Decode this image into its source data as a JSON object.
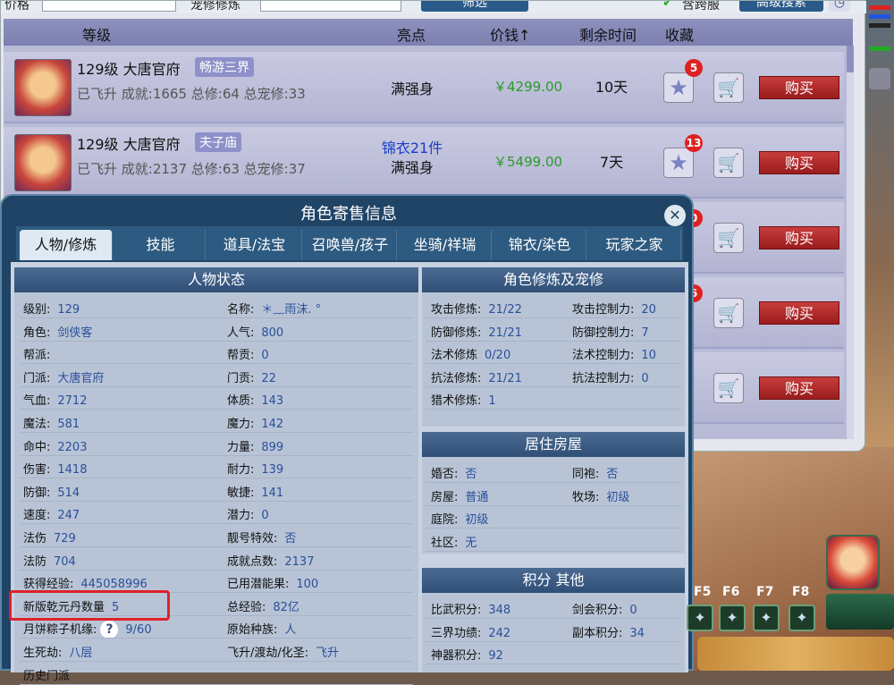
{
  "filter_bar": {
    "price_label": "价格",
    "cultivation_label": "宠修修炼",
    "filter_button": "筛选",
    "cross_server_label": "含跨服",
    "advanced_search": "高级搜索"
  },
  "list_header": {
    "grade": "等级",
    "highlight": "亮点",
    "price": "价钱",
    "remaining": "剩余时间",
    "favorite": "收藏"
  },
  "listings": [
    {
      "title": "129级 大唐官府",
      "tag": "畅游三界",
      "sub": "已飞升 成就:1665 总修:64 总宠修:33",
      "highlight": [
        "满强身"
      ],
      "price": "￥4299.00",
      "time": "10天",
      "fav_count": "5",
      "buy_label": "购买"
    },
    {
      "title": "129级 大唐官府",
      "tag": "夫子庙",
      "sub": "已飞升 成就:2137 总修:63 总宠修:37",
      "highlight": [
        "锦衣21件",
        "满强身"
      ],
      "price": "￥5499.00",
      "time": "7天",
      "fav_count": "13",
      "buy_label": "购买"
    },
    {
      "buy_label": "购买",
      "fav_count": "0"
    },
    {
      "buy_label": "购买",
      "fav_count": "6"
    },
    {
      "buy_label": "购买"
    }
  ],
  "dialog": {
    "title": "角色寄售信息",
    "tabs": [
      "人物/修炼",
      "技能",
      "道具/法宝",
      "召唤兽/孩子",
      "坐骑/祥瑞",
      "锦衣/染色",
      "玩家之家"
    ],
    "status_title": "人物状态",
    "status_left": [
      [
        "级别:",
        "129"
      ],
      [
        "角色:",
        "剑侠客"
      ],
      [
        "帮派:",
        ""
      ],
      [
        "门派:",
        "大唐官府"
      ],
      [
        "气血:",
        "2712"
      ],
      [
        "魔法:",
        "581"
      ],
      [
        "命中:",
        "2203"
      ],
      [
        "伤害:",
        "1418"
      ],
      [
        "防御:",
        "514"
      ],
      [
        "速度:",
        "247"
      ],
      [
        "法伤",
        "729"
      ],
      [
        "法防",
        "704"
      ],
      [
        "获得经验:",
        "445058996"
      ],
      [
        "新版乾元丹数量",
        "5"
      ],
      [
        "月饼粽子机缘:",
        "9/60"
      ],
      [
        "生死劫:",
        "八层"
      ],
      [
        "历史门派",
        ""
      ]
    ],
    "status_right": [
      [
        "名称:",
        "＊﹏雨沫. °"
      ],
      [
        "人气:",
        "800"
      ],
      [
        "帮贡:",
        "0"
      ],
      [
        "门贡:",
        "22"
      ],
      [
        "体质:",
        "143"
      ],
      [
        "魔力:",
        "142"
      ],
      [
        "力量:",
        "899"
      ],
      [
        "耐力:",
        "139"
      ],
      [
        "敏捷:",
        "141"
      ],
      [
        "潜力:",
        "0"
      ],
      [
        "靓号特效:",
        "否"
      ],
      [
        "成就点数:",
        "2137"
      ],
      [
        "已用潜能果:",
        "100"
      ],
      [
        "总经验:",
        "82亿"
      ],
      [
        "原始种族:",
        "人"
      ],
      [
        "飞升/渡劫/化圣:",
        "飞升"
      ]
    ],
    "cultivation_title": "角色修炼及宠修",
    "cultivation": [
      [
        "攻击修炼:",
        "21/22",
        "攻击控制力:",
        "20"
      ],
      [
        "防御修炼:",
        "21/21",
        "防御控制力:",
        "7"
      ],
      [
        "法术修炼",
        "0/20",
        "法术控制力:",
        "10"
      ],
      [
        "抗法修炼:",
        "21/21",
        "抗法控制力:",
        "0"
      ],
      [
        "猎术修炼:",
        "1",
        "",
        ""
      ]
    ],
    "housing_title": "居住房屋",
    "housing": [
      [
        "婚否:",
        "否",
        "同袍:",
        "否"
      ],
      [
        "房屋:",
        "普通",
        "牧场:",
        "初级"
      ],
      [
        "庭院:",
        "初级",
        "",
        ""
      ],
      [
        "社区:",
        "无",
        "",
        ""
      ]
    ],
    "points_title": "积分 其他",
    "points": [
      [
        "比武积分:",
        "348",
        "剑会积分:",
        "0"
      ],
      [
        "三界功绩:",
        "242",
        "副本积分:",
        "34"
      ],
      [
        "神器积分:",
        "92",
        "",
        ""
      ]
    ]
  },
  "hotkeys": [
    "F5",
    "F6",
    "F7",
    "F8"
  ]
}
